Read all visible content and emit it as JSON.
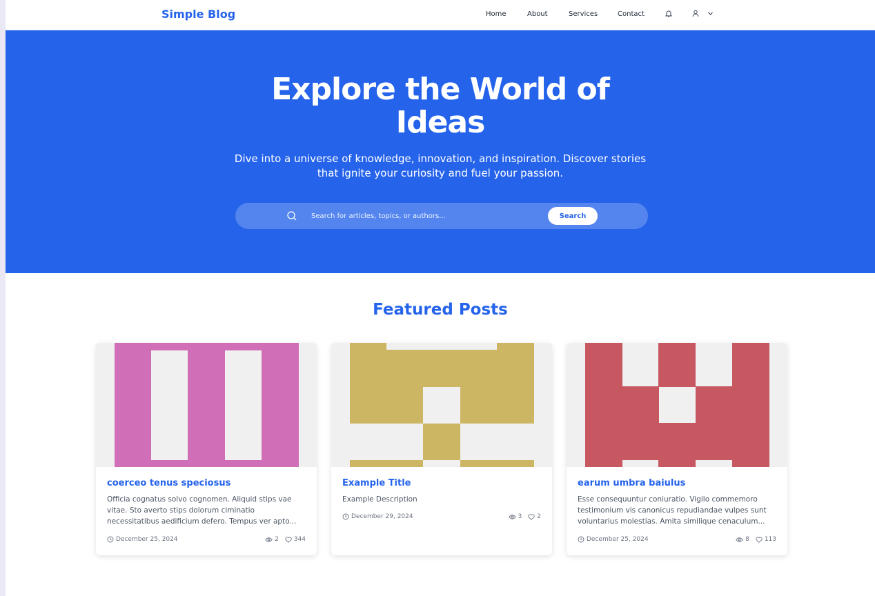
{
  "nav": {
    "brand": "Simple Blog",
    "links": [
      "Home",
      "About",
      "Services",
      "Contact"
    ],
    "icons": [
      "bell-icon",
      "user-icon",
      "chevron-down-icon"
    ]
  },
  "hero": {
    "title": "Explore the World of Ideas",
    "subtitle": "Dive into a universe of knowledge, innovation, and inspiration. Discover stories that ignite your curiosity and fuel your passion.",
    "search_placeholder": "Search for articles, topics, or authors...",
    "search_button": "Search"
  },
  "featured": {
    "heading": "Featured Posts",
    "posts": [
      {
        "title": "coerceo tenus speciosus",
        "description": "Officia cognatus solvo cognomen. Aliquid stips vae vitae. Sto averto stips dolorum ciminatio necessitatibus aedificium defero. Tempus ver apto...",
        "date": "December 25, 2024",
        "views": "2",
        "likes": "344",
        "image_color": "#d06fb8"
      },
      {
        "title": "Example Title",
        "description": "Example Description",
        "date": "December 29, 2024",
        "views": "3",
        "likes": "2",
        "image_color": "#ccb563"
      },
      {
        "title": "earum umbra baiulus",
        "description": "Esse consequuntur coniuratio. Vigilo commemoro testimonium vis canonicus repudiandae vulpes sunt voluntarius molestias. Amita similique cenaculum...",
        "date": "December 25, 2024",
        "views": "8",
        "likes": "113",
        "image_color": "#c75761"
      }
    ]
  },
  "colors": {
    "primary": "#2563eb",
    "image_background": "#f0f0f0"
  }
}
